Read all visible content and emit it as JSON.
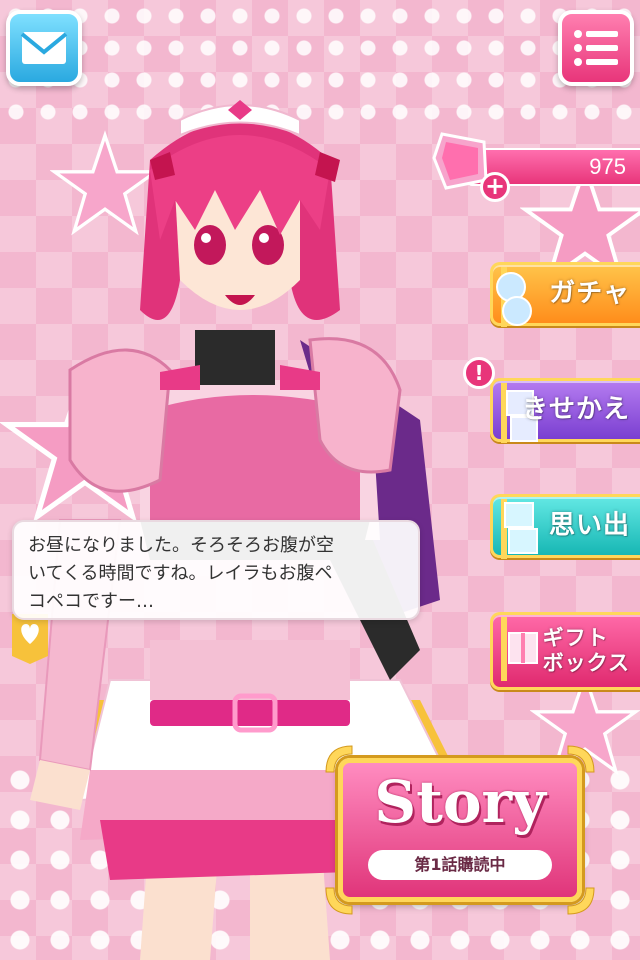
{
  "header": {
    "mail_icon": "envelope-icon",
    "menu_icon": "hamburger-menu-icon"
  },
  "currency": {
    "gem_icon": "pink-gem-icon",
    "value": "975",
    "add_label": "+"
  },
  "side_menu": {
    "gacha": "ガチャ",
    "kisekae": "きせかえ",
    "kisekae_alert": "!",
    "omoide": "思い出",
    "gift_line1": "ギフト",
    "gift_line2": "ボックス"
  },
  "dialogue": {
    "text_line1": "お昼になりました。そろそろお腹が空",
    "text_line2": "いてくる時間ですね。レイラもお腹ペ",
    "text_line3": "コペコですー…"
  },
  "story": {
    "title": "Story",
    "subtitle": "第1話購読中"
  },
  "colors": {
    "accent_pink": "#e8357a",
    "gold": "#ffd75a",
    "gacha": "#ff8d1b",
    "kisekae": "#7a3fd1",
    "omoide": "#17b7b4"
  }
}
